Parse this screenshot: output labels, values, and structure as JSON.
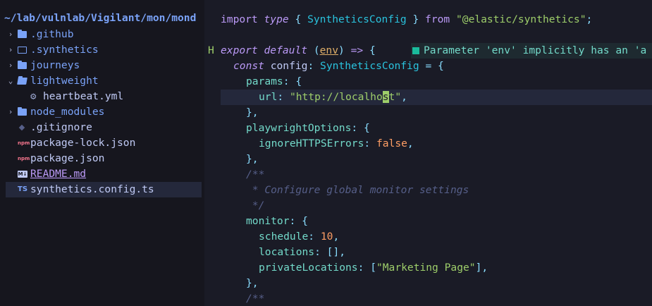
{
  "sidebar": {
    "path": "~/lab/vulnlab/Vigilant/mon/mond",
    "items": [
      {
        "name": ".github",
        "kind": "dir",
        "chevron": "›"
      },
      {
        "name": ".synthetics",
        "kind": "dir-outline",
        "chevron": "›"
      },
      {
        "name": "journeys",
        "kind": "dir",
        "chevron": "›"
      },
      {
        "name": "lightweight",
        "kind": "dir-open",
        "chevron": "⌄"
      },
      {
        "name": "heartbeat.yml",
        "kind": "yml"
      },
      {
        "name": "node_modules",
        "kind": "dir",
        "chevron": "›"
      },
      {
        "name": ".gitignore",
        "kind": "git"
      },
      {
        "name": "package-lock.json",
        "kind": "npm",
        "badge": "npm"
      },
      {
        "name": "package.json",
        "kind": "npm",
        "badge": "npm"
      },
      {
        "name": "README.md",
        "kind": "md",
        "badge": "M↓"
      },
      {
        "name": "synthetics.config.ts",
        "kind": "ts",
        "badge": "TS",
        "selected": true
      }
    ]
  },
  "editor": {
    "gutter_mark": "H",
    "diagnostic": "Parameter 'env' implicitly has an 'a",
    "code": {
      "l1": [
        "import",
        "type",
        "{",
        "SyntheticsConfig",
        "}",
        "from",
        "\"@elastic/synthetics\"",
        ";"
      ],
      "l2": [
        "export",
        "default",
        "(",
        "env",
        ")",
        "=>",
        "{"
      ],
      "l3": [
        "const",
        "config",
        ":",
        "SyntheticsConfig",
        "=",
        "{"
      ],
      "l4": [
        "params",
        ":",
        "{"
      ],
      "l5": [
        "url",
        ":",
        "\"http://localho",
        "s",
        "t\"",
        ","
      ],
      "l6": "},",
      "l7": [
        "playwrightOptions",
        ":",
        "{"
      ],
      "l8": [
        "ignoreHTTPSErrors",
        ":",
        "false",
        ","
      ],
      "l9": "},",
      "l10": "/**",
      "l11": " * Configure global monitor settings",
      "l12": " */",
      "l13": [
        "monitor",
        ":",
        "{"
      ],
      "l14": [
        "schedule",
        ":",
        "10",
        ","
      ],
      "l15": [
        "locations",
        ":",
        "[]",
        ","
      ],
      "l16": [
        "privateLocations",
        ":",
        "[",
        "\"Marketing Page\"",
        "]",
        ","
      ],
      "l17": "},",
      "l18": "/**"
    }
  },
  "colors": {
    "background": "#1a1b26",
    "sidebar": "#16161e",
    "keyword": "#bb9af7",
    "type": "#2ac3de",
    "string": "#9ece6a",
    "number": "#ff9e64"
  }
}
